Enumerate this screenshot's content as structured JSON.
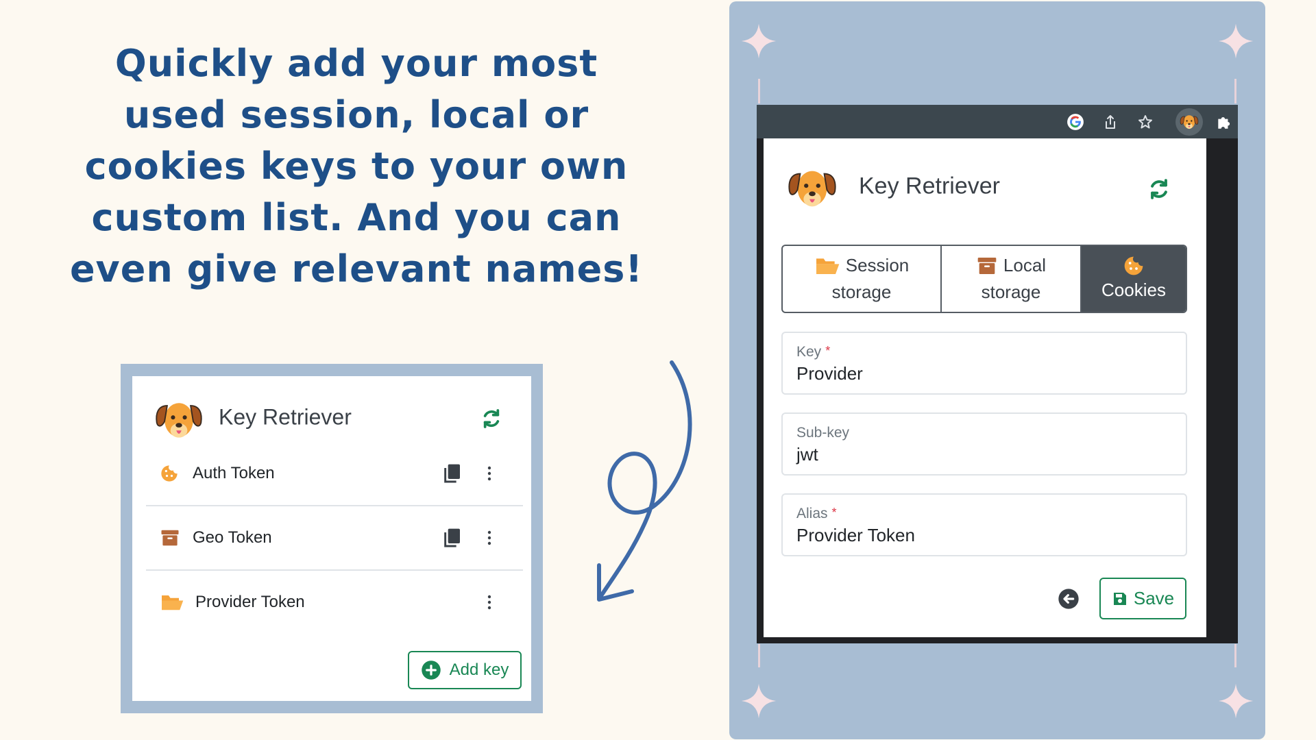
{
  "headline": {
    "lines": [
      "Quickly add your most",
      "used session, local or",
      "cookies keys to your own",
      "custom list. And you can",
      "even give relevant names!"
    ]
  },
  "mini_popup": {
    "title": "Key Retriever",
    "items": [
      {
        "label": "Auth Token",
        "icon": "cookie-icon",
        "has_copy": true
      },
      {
        "label": "Geo Token",
        "icon": "archive-box-icon",
        "has_copy": true
      },
      {
        "label": "Provider Token",
        "icon": "folder-open-icon",
        "has_copy": false
      }
    ],
    "add_key_label": "Add key"
  },
  "popup": {
    "title": "Key Retriever",
    "tabs": [
      {
        "line1": "Session",
        "line2": "storage",
        "icon": "folder-open-icon"
      },
      {
        "line1": "Local",
        "line2": "storage",
        "icon": "archive-box-icon"
      },
      {
        "line1": "Cookies",
        "line2": "",
        "icon": "cookie-icon",
        "active": true
      }
    ],
    "fields": {
      "key": {
        "label": "Key",
        "required_mark": "*",
        "value": "Provider"
      },
      "subkey": {
        "label": "Sub-key",
        "value": "jwt"
      },
      "alias": {
        "label": "Alias",
        "required_mark": "*",
        "value": "Provider Token"
      }
    },
    "save_label": "Save"
  },
  "colors": {
    "headline": "#1e4f88",
    "panel": "#a8bdd3",
    "success": "#198754",
    "required": "#dc3545",
    "cookie": "#f5a33a",
    "archive": "#b5683a"
  }
}
